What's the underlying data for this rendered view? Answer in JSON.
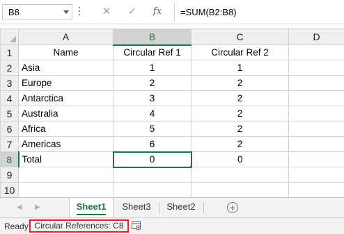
{
  "formula_bar": {
    "name_box": "B8",
    "cancel_icon": "✕",
    "enter_icon": "✓",
    "fx_label": "fx",
    "formula": "=SUM(B2:B8)"
  },
  "grid": {
    "columns": [
      "A",
      "B",
      "C",
      "D"
    ],
    "active_column": "B",
    "active_row": "8",
    "selected_cell": "B8",
    "rows": [
      {
        "num": "1",
        "cells": [
          "Name",
          "Circular Ref 1",
          "Circular Ref 2",
          ""
        ]
      },
      {
        "num": "2",
        "cells": [
          "Asia",
          "1",
          "1",
          ""
        ]
      },
      {
        "num": "3",
        "cells": [
          "Europe",
          "2",
          "2",
          ""
        ]
      },
      {
        "num": "4",
        "cells": [
          "Antarctica",
          "3",
          "2",
          ""
        ]
      },
      {
        "num": "5",
        "cells": [
          "Australia",
          "4",
          "2",
          ""
        ]
      },
      {
        "num": "6",
        "cells": [
          "Africa",
          "5",
          "2",
          ""
        ]
      },
      {
        "num": "7",
        "cells": [
          "Americas",
          "6",
          "2",
          ""
        ]
      },
      {
        "num": "8",
        "cells": [
          "Total",
          "0",
          "0",
          ""
        ]
      },
      {
        "num": "9",
        "cells": [
          "",
          "",
          "",
          ""
        ]
      },
      {
        "num": "10",
        "cells": [
          "",
          "",
          "",
          ""
        ]
      }
    ]
  },
  "sheet_tabs": {
    "tabs": [
      "Sheet1",
      "Sheet3",
      "Sheet2"
    ],
    "active": "Sheet1",
    "add_icon": "+"
  },
  "status_bar": {
    "ready": "Ready",
    "circular_references": "Circular References: C8"
  },
  "colors": {
    "accent": "#217346",
    "highlight_border": "#e0262a"
  }
}
